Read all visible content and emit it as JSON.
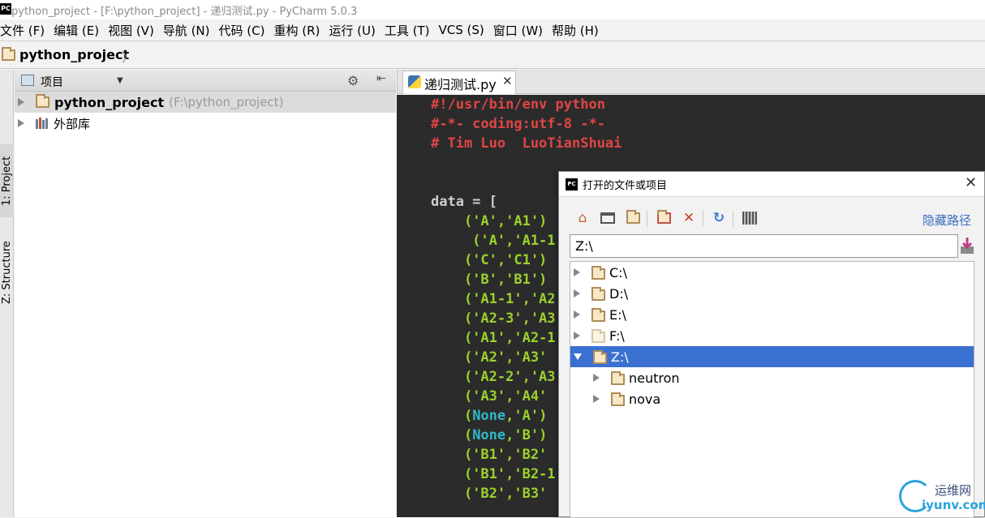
{
  "window": {
    "title": "python_project - [F:\\python_project] - 递归测试.py - PyCharm 5.0.3",
    "app_icon": "PC"
  },
  "menu": [
    "文件 (F)",
    "编辑 (E)",
    "视图 (V)",
    "导航 (N)",
    "代码 (C)",
    "重构 (R)",
    "运行 (U)",
    "工具 (T)",
    "VCS (S)",
    "窗口 (W)",
    "帮助 (H)"
  ],
  "navbar": {
    "breadcrumb": "python_project"
  },
  "toolstrip": {
    "project_tab": "1: Project",
    "structure_tab": "Z: Structure"
  },
  "project_panel": {
    "view_label": "项目",
    "tree": [
      {
        "name": "python_project",
        "path": "(F:\\python_project)",
        "icon": "folder-icon",
        "selected": true
      },
      {
        "name": "外部库",
        "path": "",
        "icon": "library-icon",
        "selected": false
      }
    ]
  },
  "editor": {
    "tab_label": "递归测试.py",
    "lines": [
      {
        "text": "#!/usr/bin/env python",
        "kind": "comment"
      },
      {
        "text": "#-*- coding:utf-8 -*-",
        "kind": "comment"
      },
      {
        "text": "# Tim Luo  LuoTianShuai",
        "kind": "comment"
      },
      {
        "text": "",
        "kind": "plain"
      },
      {
        "text": "",
        "kind": "plain"
      },
      {
        "text": "data = [",
        "kind": "plain"
      },
      {
        "text": "    ('A','A1')",
        "kind": "str"
      },
      {
        "text": "     ('A','A1-1",
        "kind": "str"
      },
      {
        "text": "    ('C','C1')",
        "kind": "str"
      },
      {
        "text": "    ('B','B1')",
        "kind": "str"
      },
      {
        "text": "    ('A1-1','A2",
        "kind": "str"
      },
      {
        "text": "    ('A2-3','A3",
        "kind": "str"
      },
      {
        "text": "    ('A1','A2-1",
        "kind": "str"
      },
      {
        "text": "    ('A2','A3'",
        "kind": "str"
      },
      {
        "text": "    ('A2-2','A3",
        "kind": "str"
      },
      {
        "text": "    ('A3','A4'",
        "kind": "str"
      },
      {
        "text": "    (None,'A')",
        "kind": "none"
      },
      {
        "text": "    (None,'B')",
        "kind": "none"
      },
      {
        "text": "    ('B1','B2'",
        "kind": "str"
      },
      {
        "text": "    ('B1','B2-1",
        "kind": "str"
      },
      {
        "text": "    ('B2','B3'",
        "kind": "str"
      }
    ]
  },
  "dialog": {
    "title": "打开的文件或项目",
    "app_icon": "PC",
    "hide_path_label": "隐藏路径",
    "path_value": "Z:\\",
    "toolbar_icons": [
      "home-icon",
      "desktop-icon",
      "project-folder-icon",
      "new-folder-icon",
      "delete-icon",
      "refresh-icon",
      "show-hidden-icon"
    ],
    "tree": [
      {
        "label": "C:\\",
        "depth": 0,
        "expanded": false,
        "selected": false,
        "faded": false
      },
      {
        "label": "D:\\",
        "depth": 0,
        "expanded": false,
        "selected": false,
        "faded": false
      },
      {
        "label": "E:\\",
        "depth": 0,
        "expanded": false,
        "selected": false,
        "faded": false
      },
      {
        "label": "F:\\",
        "depth": 0,
        "expanded": false,
        "selected": false,
        "faded": true
      },
      {
        "label": "Z:\\",
        "depth": 0,
        "expanded": true,
        "selected": true,
        "faded": false
      },
      {
        "label": "neutron",
        "depth": 1,
        "expanded": false,
        "selected": false,
        "faded": false
      },
      {
        "label": "nova",
        "depth": 1,
        "expanded": false,
        "selected": false,
        "faded": false
      }
    ]
  },
  "watermark": {
    "cn": "运维网",
    "en": "iyunv.com"
  },
  "colors": {
    "selection": "#3a71d0",
    "link": "#3a6dbf",
    "comment": "#e04545",
    "string": "#9bd12d",
    "keyword": "#2fb8c8"
  }
}
